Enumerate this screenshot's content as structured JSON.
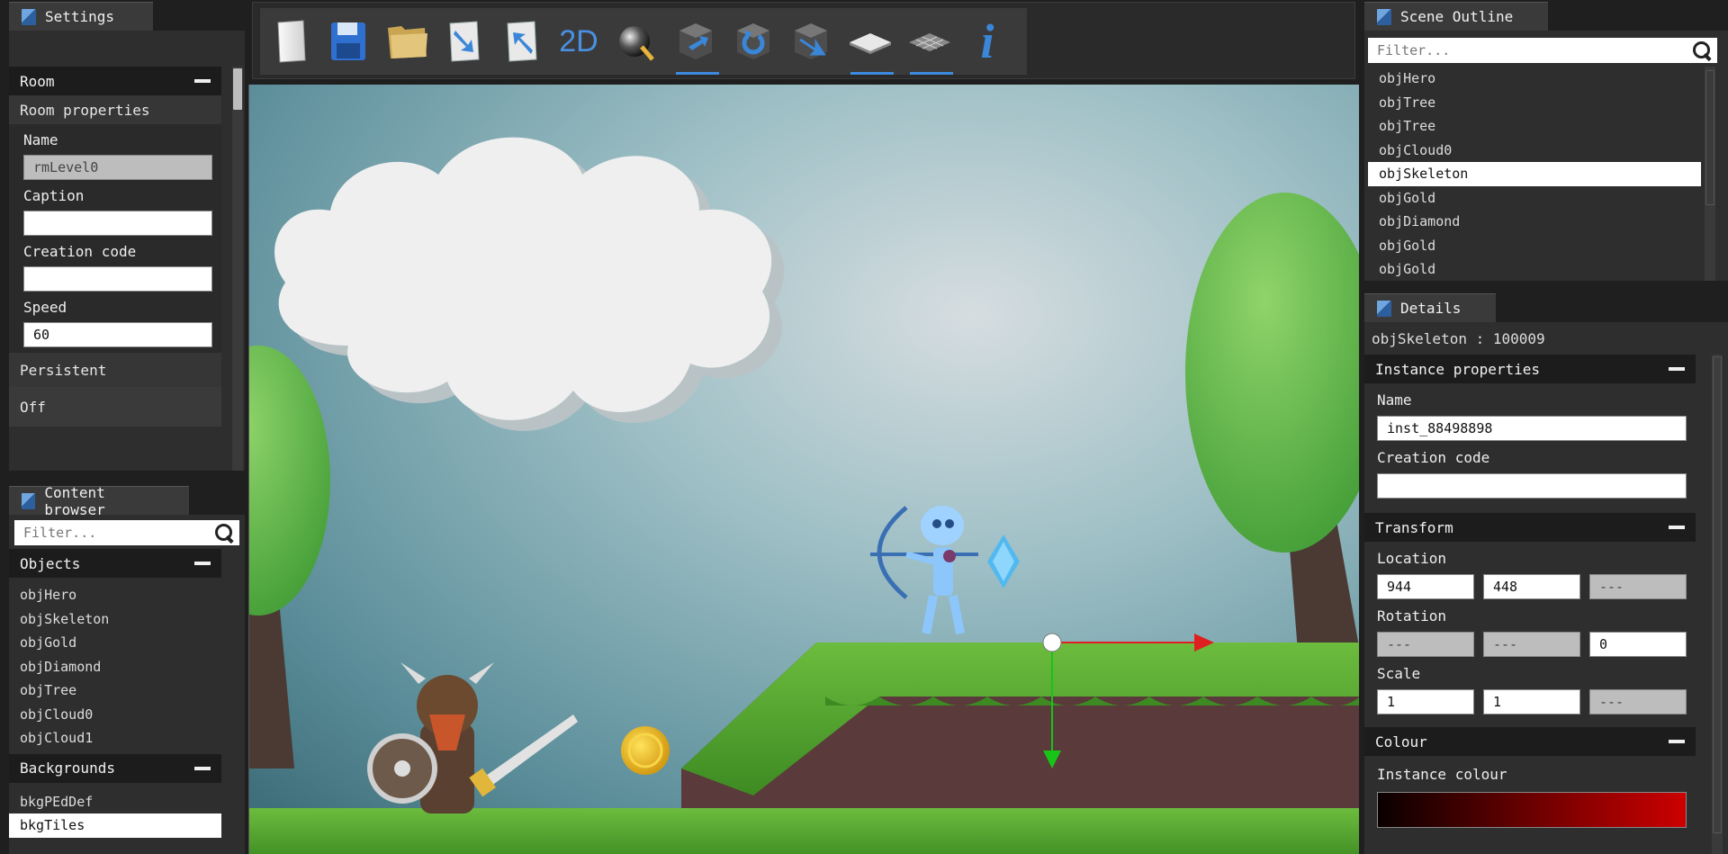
{
  "settings": {
    "tab": "Settings",
    "room_header": "Room",
    "room_props": "Room properties",
    "name_label": "Name",
    "name_value": "rmLevel0",
    "caption_label": "Caption",
    "caption_value": "",
    "creation_label": "Creation code",
    "creation_value": "",
    "speed_label": "Speed",
    "speed_value": "60",
    "persistent_label": "Persistent",
    "persistent_value": "Off"
  },
  "content": {
    "tab": "Content browser",
    "filter_placeholder": "Filter...",
    "objects_header": "Objects",
    "objects": [
      "objHero",
      "objSkeleton",
      "objGold",
      "objDiamond",
      "objTree",
      "objCloud0",
      "objCloud1"
    ],
    "backgrounds_header": "Backgrounds",
    "backgrounds": [
      "bkgPEdDef",
      "bkgTiles"
    ]
  },
  "toolbar": {
    "items": [
      "new-file-icon",
      "save-icon",
      "open-folder-icon",
      "import-icon",
      "export-icon",
      "2d-mode",
      "sphere-paint-icon",
      "cube-move-icon",
      "cube-rotate-icon",
      "cube-scale-icon",
      "grid-solid-icon",
      "grid-wire-icon",
      "info-icon"
    ],
    "label_2d": "2D",
    "label_info": "i"
  },
  "outline": {
    "tab": "Scene Outline",
    "filter_placeholder": "Filter...",
    "items": [
      "objHero",
      "objTree",
      "objTree",
      "objCloud0",
      "objSkeleton",
      "objGold",
      "objDiamond",
      "objGold",
      "objGold"
    ],
    "selected_index": 4
  },
  "details": {
    "tab": "Details",
    "instance_title": "objSkeleton : 100009",
    "instance_header": "Instance properties",
    "name_label": "Name",
    "name_value": "inst_88498898",
    "creation_label": "Creation code",
    "creation_value": "",
    "transform_header": "Transform",
    "location_label": "Location",
    "location": [
      "944",
      "448",
      "---"
    ],
    "rotation_label": "Rotation",
    "rotation": [
      "---",
      "---",
      "0"
    ],
    "scale_label": "Scale",
    "scale": [
      "1",
      "1",
      "---"
    ],
    "colour_header": "Colour",
    "instance_colour_label": "Instance colour"
  },
  "colors": {
    "accent": "#3d8be0",
    "panel": "#2e2e2e",
    "header": "#1c1c1c",
    "selected": "#ffffff"
  }
}
